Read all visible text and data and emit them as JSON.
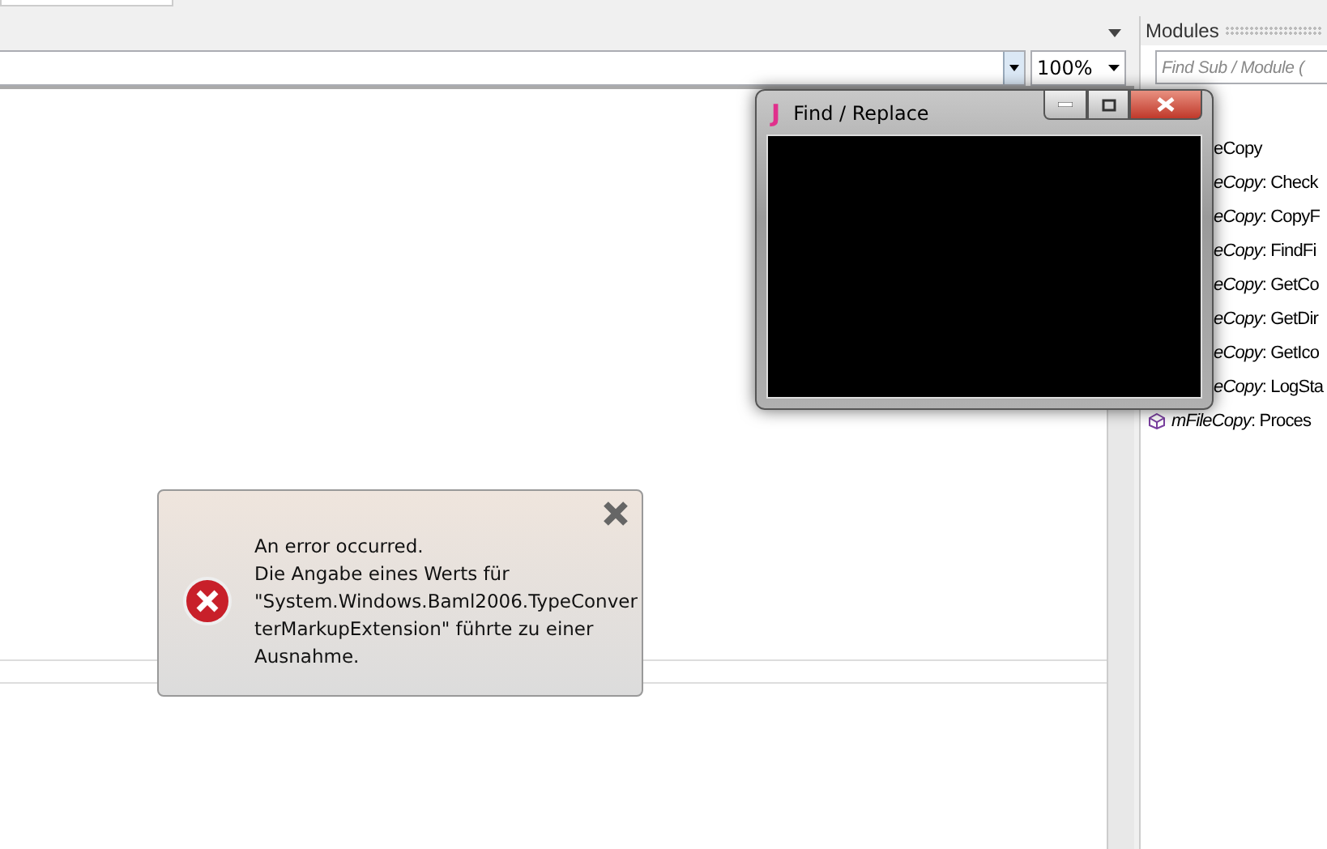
{
  "toolbar": {
    "zoom": "100%"
  },
  "modules_panel": {
    "title": "Modules",
    "search": {
      "placeholder": "Find Sub / Module ("
    },
    "items": [
      {
        "text": "eCopy",
        "kind": "module"
      },
      {
        "text": "*eCopy*: Check",
        "kind": "sub"
      },
      {
        "text": "*eCopy*: CopyF",
        "kind": "sub"
      },
      {
        "text": "*eCopy*: FindFi",
        "kind": "sub"
      },
      {
        "text": "*eCopy*: GetCo",
        "kind": "sub"
      },
      {
        "text": "*eCopy*: GetDir",
        "kind": "sub"
      },
      {
        "text": "*eCopy*: GetIco",
        "kind": "sub"
      },
      {
        "text": "*eCopy*: LogSta",
        "kind": "sub"
      },
      {
        "text": "*mFileCopy*: Proces",
        "kind": "sub-icon"
      }
    ]
  },
  "find_window": {
    "icon": "J",
    "title": "Find / Replace"
  },
  "error_toast": {
    "lines": [
      "An error occurred.",
      "Die Angabe eines Werts für",
      "\"System.Windows.Baml2006.TypeConver",
      "terMarkupExtension\" führte zu einer",
      "Ausnahme."
    ]
  }
}
